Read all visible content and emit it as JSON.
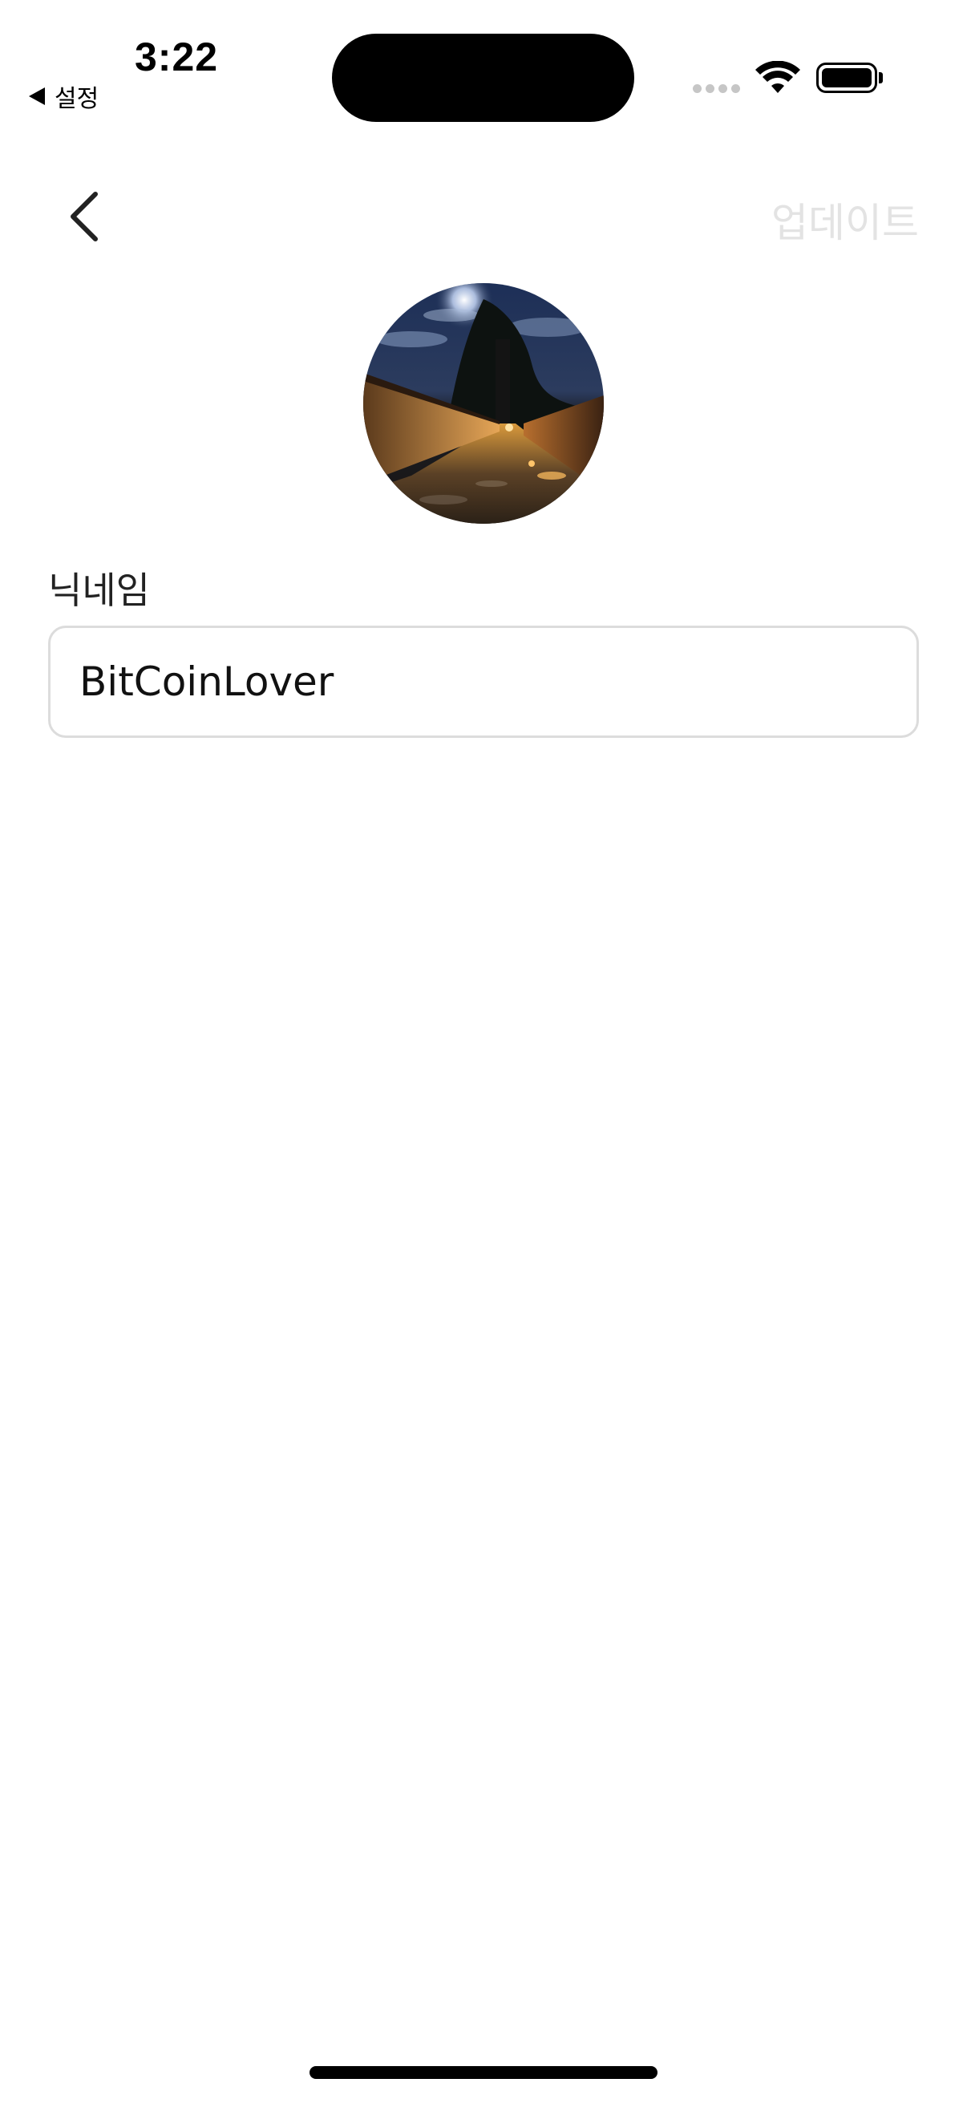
{
  "status_bar": {
    "time": "3:22",
    "back_app_label": "설정",
    "signal_icon": "cellular-signal-icon",
    "wifi_icon": "wifi-icon",
    "battery_icon": "battery-icon",
    "battery_level": 1.0
  },
  "nav": {
    "back_icon": "chevron-left-icon",
    "update_label": "업데이트",
    "update_color": "#e3e3e3"
  },
  "profile": {
    "avatar_description_icon": "profile-photo"
  },
  "form": {
    "nickname_label": "닉네임",
    "nickname_value": "BitCoinLover"
  },
  "colors": {
    "background": "#ffffff",
    "input_border": "#dcdcdc",
    "text": "#111111"
  }
}
